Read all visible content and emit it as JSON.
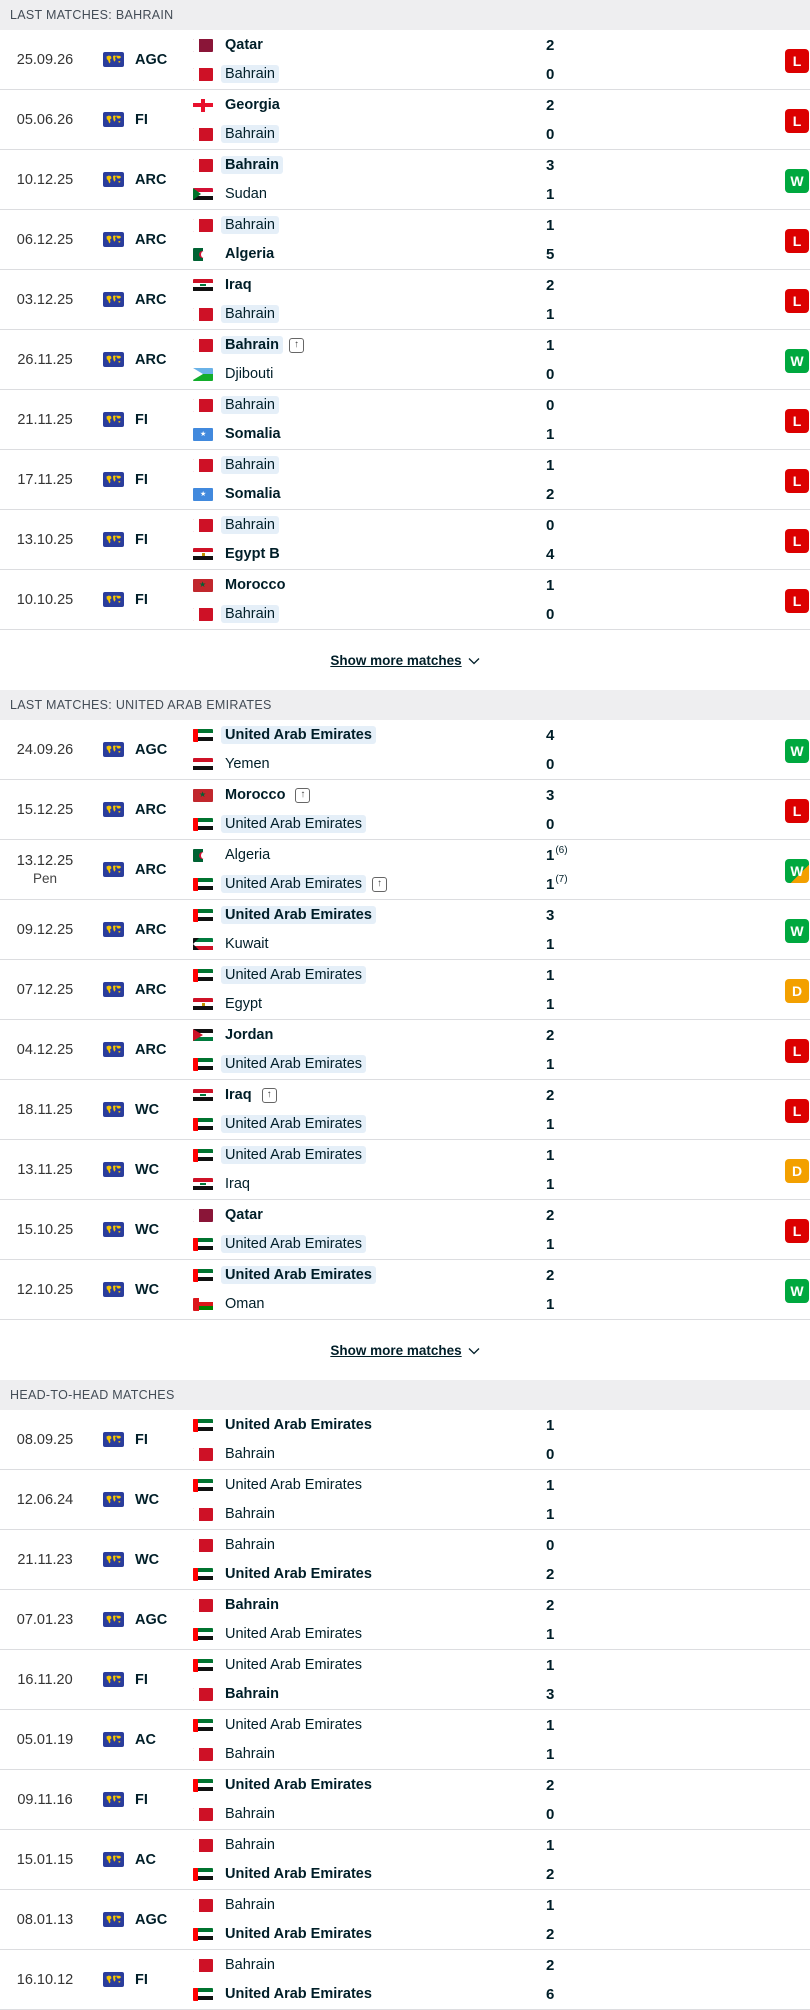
{
  "sections": [
    {
      "title": "LAST MATCHES: BAHRAIN",
      "show_more": "Show more matches",
      "matches": [
        {
          "date": "25.09.26",
          "comp": "AGC",
          "home": {
            "name": "Qatar",
            "flag": "qatar",
            "bold": true,
            "hl": false
          },
          "away": {
            "name": "Bahrain",
            "flag": "bahrain",
            "bold": false,
            "hl": true
          },
          "score_home": "2",
          "score_away": "0",
          "result": "L"
        },
        {
          "date": "05.06.26",
          "comp": "FI",
          "home": {
            "name": "Georgia",
            "flag": "georgia",
            "bold": true,
            "hl": false
          },
          "away": {
            "name": "Bahrain",
            "flag": "bahrain",
            "bold": false,
            "hl": true
          },
          "score_home": "2",
          "score_away": "0",
          "result": "L"
        },
        {
          "date": "10.12.25",
          "comp": "ARC",
          "home": {
            "name": "Bahrain",
            "flag": "bahrain",
            "bold": true,
            "hl": true
          },
          "away": {
            "name": "Sudan",
            "flag": "sudan",
            "bold": false,
            "hl": false
          },
          "score_home": "3",
          "score_away": "1",
          "result": "W"
        },
        {
          "date": "06.12.25",
          "comp": "ARC",
          "home": {
            "name": "Bahrain",
            "flag": "bahrain",
            "bold": false,
            "hl": true
          },
          "away": {
            "name": "Algeria",
            "flag": "algeria",
            "bold": true,
            "hl": false
          },
          "score_home": "1",
          "score_away": "5",
          "result": "L"
        },
        {
          "date": "03.12.25",
          "comp": "ARC",
          "home": {
            "name": "Iraq",
            "flag": "iraq",
            "bold": true,
            "hl": false
          },
          "away": {
            "name": "Bahrain",
            "flag": "bahrain",
            "bold": false,
            "hl": true
          },
          "score_home": "2",
          "score_away": "1",
          "result": "L"
        },
        {
          "date": "26.11.25",
          "comp": "ARC",
          "home": {
            "name": "Bahrain",
            "flag": "bahrain",
            "bold": true,
            "hl": true,
            "arrow": true
          },
          "away": {
            "name": "Djibouti",
            "flag": "djibouti",
            "bold": false,
            "hl": false
          },
          "score_home": "1",
          "score_away": "0",
          "result": "W"
        },
        {
          "date": "21.11.25",
          "comp": "FI",
          "home": {
            "name": "Bahrain",
            "flag": "bahrain",
            "bold": false,
            "hl": true
          },
          "away": {
            "name": "Somalia",
            "flag": "somalia",
            "bold": true,
            "hl": false
          },
          "score_home": "0",
          "score_away": "1",
          "result": "L"
        },
        {
          "date": "17.11.25",
          "comp": "FI",
          "home": {
            "name": "Bahrain",
            "flag": "bahrain",
            "bold": false,
            "hl": true
          },
          "away": {
            "name": "Somalia",
            "flag": "somalia",
            "bold": true,
            "hl": false
          },
          "score_home": "1",
          "score_away": "2",
          "result": "L"
        },
        {
          "date": "13.10.25",
          "comp": "FI",
          "home": {
            "name": "Bahrain",
            "flag": "bahrain",
            "bold": false,
            "hl": true
          },
          "away": {
            "name": "Egypt B",
            "flag": "egypt",
            "bold": true,
            "hl": false
          },
          "score_home": "0",
          "score_away": "4",
          "result": "L"
        },
        {
          "date": "10.10.25",
          "comp": "FI",
          "home": {
            "name": "Morocco",
            "flag": "morocco",
            "bold": true,
            "hl": false
          },
          "away": {
            "name": "Bahrain",
            "flag": "bahrain",
            "bold": false,
            "hl": true
          },
          "score_home": "1",
          "score_away": "0",
          "result": "L"
        }
      ]
    },
    {
      "title": "LAST MATCHES: UNITED ARAB EMIRATES",
      "show_more": "Show more matches",
      "matches": [
        {
          "date": "24.09.26",
          "comp": "AGC",
          "home": {
            "name": "United Arab Emirates",
            "flag": "uae",
            "bold": true,
            "hl": true
          },
          "away": {
            "name": "Yemen",
            "flag": "yemen",
            "bold": false,
            "hl": false
          },
          "score_home": "4",
          "score_away": "0",
          "result": "W"
        },
        {
          "date": "15.12.25",
          "comp": "ARC",
          "home": {
            "name": "Morocco",
            "flag": "morocco",
            "bold": true,
            "hl": false,
            "arrow": true
          },
          "away": {
            "name": "United Arab Emirates",
            "flag": "uae",
            "bold": false,
            "hl": true
          },
          "score_home": "3",
          "score_away": "0",
          "result": "L"
        },
        {
          "date": "13.12.25",
          "note": "Pen",
          "comp": "ARC",
          "home": {
            "name": "Algeria",
            "flag": "algeria",
            "bold": false,
            "hl": false
          },
          "away": {
            "name": "United Arab Emirates",
            "flag": "uae",
            "bold": false,
            "hl": true,
            "arrow": true
          },
          "score_home": "1",
          "score_away": "1",
          "pen_home": "(6)",
          "pen_away": "(7)",
          "result": "WD"
        },
        {
          "date": "09.12.25",
          "comp": "ARC",
          "home": {
            "name": "United Arab Emirates",
            "flag": "uae",
            "bold": true,
            "hl": true
          },
          "away": {
            "name": "Kuwait",
            "flag": "kuwait",
            "bold": false,
            "hl": false
          },
          "score_home": "3",
          "score_away": "1",
          "result": "W"
        },
        {
          "date": "07.12.25",
          "comp": "ARC",
          "home": {
            "name": "United Arab Emirates",
            "flag": "uae",
            "bold": false,
            "hl": true
          },
          "away": {
            "name": "Egypt",
            "flag": "egypt",
            "bold": false,
            "hl": false
          },
          "score_home": "1",
          "score_away": "1",
          "result": "D"
        },
        {
          "date": "04.12.25",
          "comp": "ARC",
          "home": {
            "name": "Jordan",
            "flag": "jordan",
            "bold": true,
            "hl": false
          },
          "away": {
            "name": "United Arab Emirates",
            "flag": "uae",
            "bold": false,
            "hl": true
          },
          "score_home": "2",
          "score_away": "1",
          "result": "L"
        },
        {
          "date": "18.11.25",
          "comp": "WC",
          "home": {
            "name": "Iraq",
            "flag": "iraq",
            "bold": true,
            "hl": false,
            "arrow": true
          },
          "away": {
            "name": "United Arab Emirates",
            "flag": "uae",
            "bold": false,
            "hl": true
          },
          "score_home": "2",
          "score_away": "1",
          "result": "L"
        },
        {
          "date": "13.11.25",
          "comp": "WC",
          "home": {
            "name": "United Arab Emirates",
            "flag": "uae",
            "bold": false,
            "hl": true
          },
          "away": {
            "name": "Iraq",
            "flag": "iraq",
            "bold": false,
            "hl": false
          },
          "score_home": "1",
          "score_away": "1",
          "result": "D"
        },
        {
          "date": "15.10.25",
          "comp": "WC",
          "home": {
            "name": "Qatar",
            "flag": "qatar",
            "bold": true,
            "hl": false
          },
          "away": {
            "name": "United Arab Emirates",
            "flag": "uae",
            "bold": false,
            "hl": true
          },
          "score_home": "2",
          "score_away": "1",
          "result": "L"
        },
        {
          "date": "12.10.25",
          "comp": "WC",
          "home": {
            "name": "United Arab Emirates",
            "flag": "uae",
            "bold": true,
            "hl": true
          },
          "away": {
            "name": "Oman",
            "flag": "oman",
            "bold": false,
            "hl": false
          },
          "score_home": "2",
          "score_away": "1",
          "result": "W"
        }
      ]
    },
    {
      "title": "HEAD-TO-HEAD MATCHES",
      "matches": [
        {
          "date": "08.09.25",
          "comp": "FI",
          "home": {
            "name": "United Arab Emirates",
            "flag": "uae",
            "bold": true,
            "hl": false
          },
          "away": {
            "name": "Bahrain",
            "flag": "bahrain",
            "bold": false,
            "hl": false
          },
          "score_home": "1",
          "score_away": "0"
        },
        {
          "date": "12.06.24",
          "comp": "WC",
          "home": {
            "name": "United Arab Emirates",
            "flag": "uae",
            "bold": false,
            "hl": false
          },
          "away": {
            "name": "Bahrain",
            "flag": "bahrain",
            "bold": false,
            "hl": false
          },
          "score_home": "1",
          "score_away": "1"
        },
        {
          "date": "21.11.23",
          "comp": "WC",
          "home": {
            "name": "Bahrain",
            "flag": "bahrain",
            "bold": false,
            "hl": false
          },
          "away": {
            "name": "United Arab Emirates",
            "flag": "uae",
            "bold": true,
            "hl": false
          },
          "score_home": "0",
          "score_away": "2"
        },
        {
          "date": "07.01.23",
          "comp": "AGC",
          "home": {
            "name": "Bahrain",
            "flag": "bahrain",
            "bold": true,
            "hl": false
          },
          "away": {
            "name": "United Arab Emirates",
            "flag": "uae",
            "bold": false,
            "hl": false
          },
          "score_home": "2",
          "score_away": "1"
        },
        {
          "date": "16.11.20",
          "comp": "FI",
          "home": {
            "name": "United Arab Emirates",
            "flag": "uae",
            "bold": false,
            "hl": false
          },
          "away": {
            "name": "Bahrain",
            "flag": "bahrain",
            "bold": true,
            "hl": false
          },
          "score_home": "1",
          "score_away": "3"
        },
        {
          "date": "05.01.19",
          "comp": "AC",
          "home": {
            "name": "United Arab Emirates",
            "flag": "uae",
            "bold": false,
            "hl": false
          },
          "away": {
            "name": "Bahrain",
            "flag": "bahrain",
            "bold": false,
            "hl": false
          },
          "score_home": "1",
          "score_away": "1"
        },
        {
          "date": "09.11.16",
          "comp": "FI",
          "home": {
            "name": "United Arab Emirates",
            "flag": "uae",
            "bold": true,
            "hl": false
          },
          "away": {
            "name": "Bahrain",
            "flag": "bahrain",
            "bold": false,
            "hl": false
          },
          "score_home": "2",
          "score_away": "0"
        },
        {
          "date": "15.01.15",
          "comp": "AC",
          "home": {
            "name": "Bahrain",
            "flag": "bahrain",
            "bold": false,
            "hl": false
          },
          "away": {
            "name": "United Arab Emirates",
            "flag": "uae",
            "bold": true,
            "hl": false
          },
          "score_home": "1",
          "score_away": "2"
        },
        {
          "date": "08.01.13",
          "comp": "AGC",
          "home": {
            "name": "Bahrain",
            "flag": "bahrain",
            "bold": false,
            "hl": false
          },
          "away": {
            "name": "United Arab Emirates",
            "flag": "uae",
            "bold": true,
            "hl": false
          },
          "score_home": "1",
          "score_away": "2"
        },
        {
          "date": "16.10.12",
          "comp": "FI",
          "home": {
            "name": "Bahrain",
            "flag": "bahrain",
            "bold": false,
            "hl": false
          },
          "away": {
            "name": "United Arab Emirates",
            "flag": "uae",
            "bold": true,
            "hl": false
          },
          "score_home": "2",
          "score_away": "6"
        }
      ]
    }
  ],
  "colors": {
    "win": "#00a83f",
    "loss": "#dc0000",
    "draw": "#f3a000",
    "highlight": "#e5eff8",
    "section_bg": "#eeeef0",
    "competition_icon": "#2a3d9c"
  },
  "icons": {
    "competition": "world-map-icon",
    "promoted": "arrow-up-box-icon",
    "show_more": "chevron-down-icon"
  }
}
